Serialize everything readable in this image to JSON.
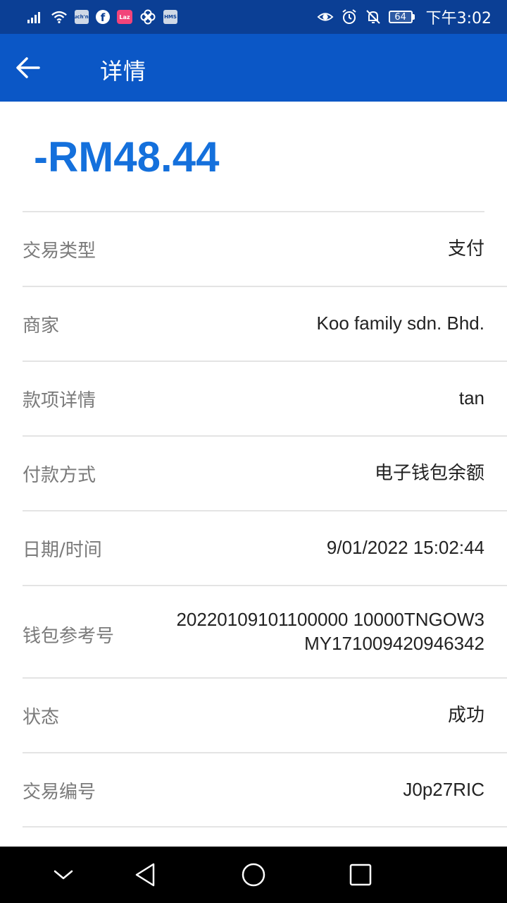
{
  "status_bar": {
    "icons_left": [
      "signal-icon",
      "wifi-icon",
      "touch-n-go-icon",
      "facebook-icon",
      "lazada-icon",
      "pinwheel-icon",
      "hms-icon"
    ],
    "touch_n_go_text": "Touch'nGo",
    "lazada_text": "Laz",
    "hms_text": "HMS",
    "icons_right": [
      "eye-icon",
      "alarm-icon",
      "mute-icon"
    ],
    "battery": "64",
    "time": "下午3:02"
  },
  "app_bar": {
    "title": "详情",
    "color": "#0b57c6"
  },
  "amount": "-RM48.44",
  "amount_color": "#1470dc",
  "rows": [
    {
      "label": "交易类型",
      "value": "支付"
    },
    {
      "label": "商家",
      "value": "Koo family sdn. Bhd."
    },
    {
      "label": "款项详情",
      "value": "tan"
    },
    {
      "label": "付款方式",
      "value": "电子钱包余额"
    },
    {
      "label": "日期/时间",
      "value": "9/01/2022 15:02:44"
    },
    {
      "label": "钱包参考号",
      "value_line1": "20220109101100000 10000TNGOW3",
      "value_line2": "MY171009420946342"
    },
    {
      "label": "状态",
      "value": "成功"
    },
    {
      "label": "交易编号",
      "value": "J0p27RIC"
    }
  ],
  "nav_bar": {
    "buttons": [
      "collapse-icon",
      "back-triangle-icon",
      "home-circle-icon",
      "recents-square-icon"
    ]
  }
}
